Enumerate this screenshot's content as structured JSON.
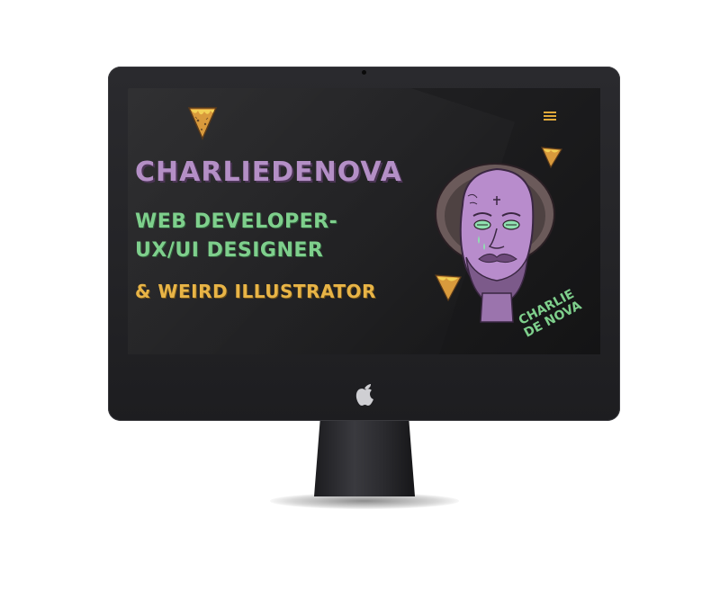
{
  "site": {
    "headline": "CHARLIEDENOVA",
    "role_line1": "WEB DEVELOPER-",
    "role_line2": "UX/UI DESIGNER",
    "role_line3": "& WEIRD ILLUSTRATOR",
    "signature_line1": "CHARLIE",
    "signature_line2": "DE NOVA"
  },
  "icons": {
    "logo": "nacho-triangle-logo",
    "menu": "hamburger-menu-icon",
    "device": "apple-logo-icon"
  },
  "colors": {
    "headline": "#b48fc6",
    "roles": "#7ecf8c",
    "accent": "#e8b446",
    "screen_bg": "#1e1e20",
    "monitor": "#2a2a2e"
  }
}
